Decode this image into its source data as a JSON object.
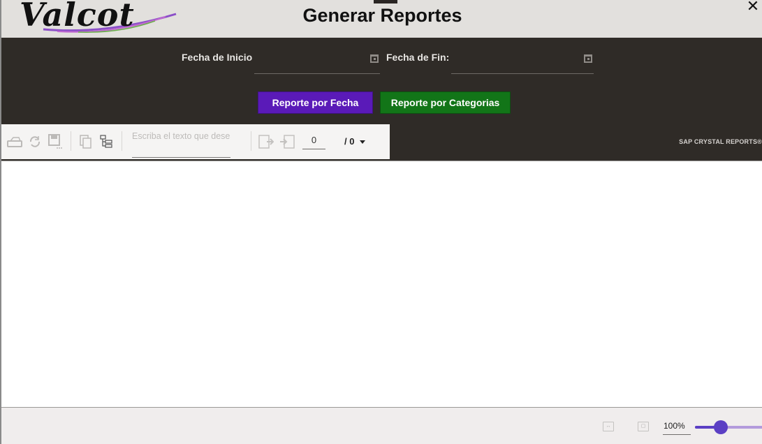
{
  "header": {
    "logo_text": "Valcot",
    "title": "Generar Reportes",
    "close_symbol": "✕"
  },
  "filters": {
    "start_label": "Fecha de Inicio",
    "start_value": "",
    "end_label": "Fecha de Fin:",
    "end_value": "",
    "calendar_icon": "calendar-icon"
  },
  "buttons": {
    "by_date": "Reporte por Fecha",
    "by_category": "Reporte por Categorias"
  },
  "report_toolbar": {
    "search_placeholder": "Escriba el texto que desea buscar",
    "page_current": "0",
    "page_total": "/ 0",
    "brand": "SAP CRYSTAL REPORTS®",
    "icons": [
      "export-icon",
      "refresh-icon",
      "print-icon",
      "copy-icon",
      "group-tree-icon",
      "previous-page-icon",
      "next-page-icon"
    ]
  },
  "status_bar": {
    "zoom_label": "100%",
    "zoom_level": 0.25,
    "icons": [
      "fit-width-icon",
      "fit-page-icon"
    ]
  },
  "colors": {
    "header_bg": "#e2e0dd",
    "band_bg": "#2f2b27",
    "btn_fecha": "#5a1ab8",
    "btn_categorias": "#127518",
    "slider_accent": "#5b3fc4"
  }
}
